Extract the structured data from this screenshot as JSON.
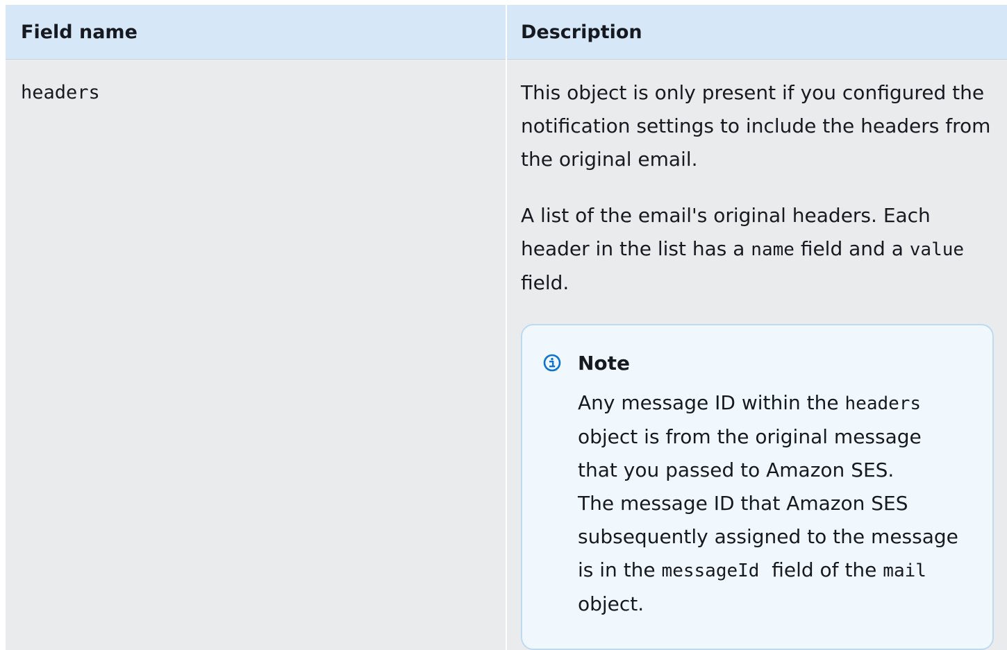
{
  "table": {
    "headers": {
      "field": "Field name",
      "description": "Description"
    },
    "row": {
      "field_name": "headers",
      "desc_p1": "This object is only present if you configured the notification settings to include the headers from the original email.",
      "desc_p2": {
        "t1": "A list of the email's original headers. Each header in the list has a ",
        "code1": "name",
        "t2": " field and a ",
        "code2": "value",
        "t3": " field."
      },
      "note": {
        "icon": "info-icon",
        "title": "Note",
        "t1": "Any message ID within the ",
        "code1": "headers",
        "t2": " object is from the original message that you passed to Amazon SES.",
        "t3": "The message ID that Amazon SES subsequently assigned to the message is in the ",
        "code2": "messageId",
        "t4": "  field of the ",
        "code3": "mail",
        "t5": " object."
      }
    }
  },
  "colors": {
    "header_bg": "#d6e8f8",
    "cell_bg": "#eaebed",
    "note_bg": "#f0f8fe",
    "note_border": "#bcdaf2",
    "info_icon": "#0972d3"
  }
}
